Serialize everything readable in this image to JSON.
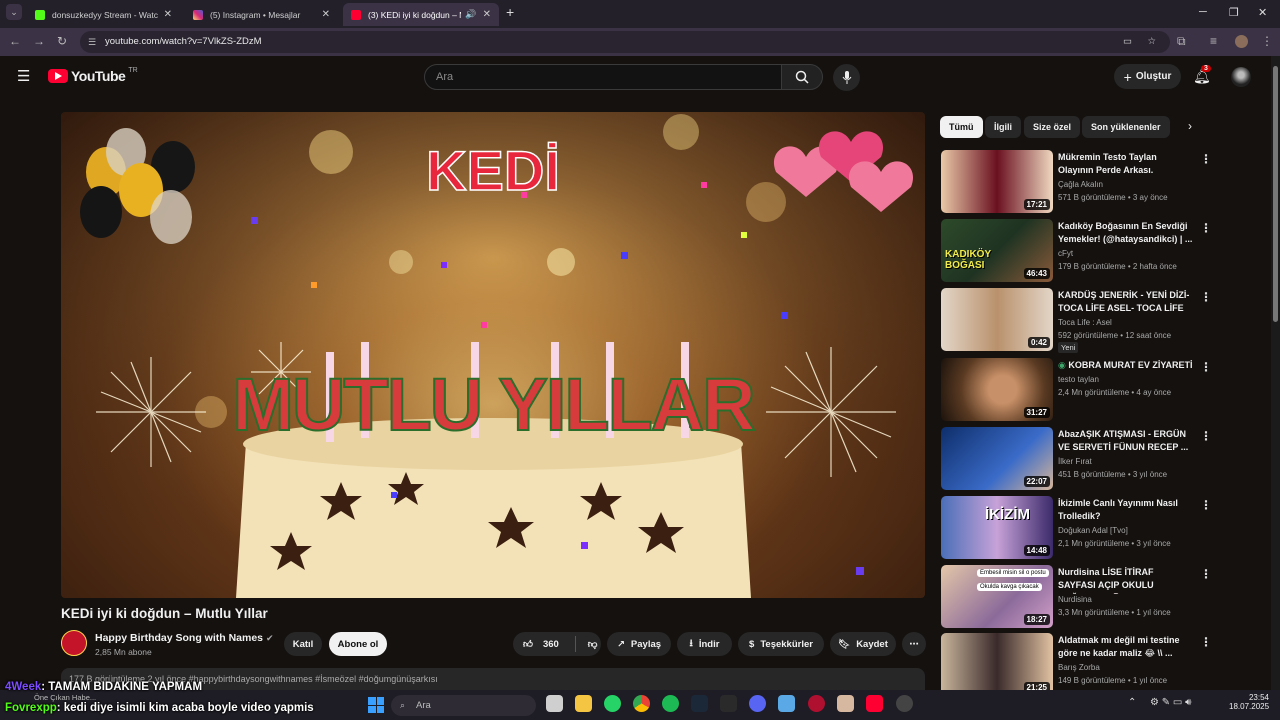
{
  "browser": {
    "tabs": [
      {
        "title": "donsuzkedyy Stream - Watch L",
        "color": "#53fc18"
      },
      {
        "title": "(5) Instagram • Mesajlar",
        "color": "#d6249f"
      },
      {
        "title": "(3) KEDi iyi ki doğdun – Mu",
        "color": "#ff0033"
      }
    ],
    "url": "youtube.com/watch?v=7VlkZS-ZDzM"
  },
  "youtube": {
    "logo": "YouTube",
    "region": "TR",
    "search_placeholder": "Ara",
    "create_label": "Oluştur",
    "notifications": "3"
  },
  "video": {
    "title": "KEDi iyi ki doğdun – Mutlu Yıllar",
    "thumb_word": "KEDİ",
    "thumb_text": "MUTLU YILLAR",
    "channel": "Happy Birthday Song with Names",
    "subscribers": "2,85 Mn abone",
    "join_label": "Katıl",
    "subscribe_label": "Abone ol",
    "likes": "360",
    "share_label": "Paylaş",
    "download_label": "İndir",
    "thanks_label": "Teşekkürler",
    "save_label": "Kaydet",
    "description": "177 B görüntüleme  2 yıl önce  #happybirthdaysongwithnames #İsmeözel #doğumgünüşarkısı"
  },
  "chips": [
    "Tümü",
    "İlgili",
    "Size özel",
    "Son yüklenenler"
  ],
  "recommendations": [
    {
      "title": "Mükremin Testo Taylan Olayının Perde Arkası.",
      "channel": "Çağla Akalın",
      "meta": "571 B görüntüleme • 3 ay önce",
      "duration": "17:21"
    },
    {
      "title": "Kadıköy Boğasının En Sevdiği Yemekler! (@hataysandikci) | ...",
      "channel": "cFyt",
      "meta": "179 B görüntüleme • 2 hafta önce",
      "duration": "46:43",
      "thumb_text": "KADIKÖY BOĞASI"
    },
    {
      "title": "KARDÜŞ JENERİK - YENİ DİZİ- TOCA LİFE ASEL- TOCA LİFE ...",
      "channel": "Toca Life : Asel",
      "meta": "592 görüntüleme • 12 saat önce",
      "duration": "0:42",
      "badge": "Yeni"
    },
    {
      "title": "KOBRA MURAT EV ZİYARETİ",
      "channel": "testo taylan",
      "meta": "2,4 Mn görüntüleme • 4 ay önce",
      "duration": "31:27"
    },
    {
      "title": "AbazAŞIK ATIŞMASI - ERGÜN VE SERVETİ FÜNUN RECEP ...",
      "channel": "İlker Fırat",
      "meta": "451 B görüntüleme • 3 yıl önce",
      "duration": "22:07"
    },
    {
      "title": "İkizimle Canlı Yayınımı Nasıl Trolledik?",
      "channel": "Doğukan Adal [Tvo]",
      "meta": "2,1 Mn görüntüleme • 3 yıl önce",
      "duration": "14:48",
      "thumb_text": "İKİZİM"
    },
    {
      "title": "Nurdisina LİSE İTİRAF SAYFASI AÇIP OKULU DAĞITIYOR 🗿 ...",
      "channel": "Nurdisina",
      "meta": "3,3 Mn görüntüleme • 1 yıl önce",
      "duration": "18:27",
      "thumb_text": "Embesil misin sil o postu",
      "thumb_text2": "Okulda kavga çıkacak"
    },
    {
      "title": "Aldatmak mı değil mi testine göre ne kadar maliz 😂 \\\\ ...",
      "channel": "Barış Zorba",
      "meta": "149 B görüntüleme • 1 yıl önce",
      "duration": "21:25"
    }
  ],
  "chat": [
    {
      "user": "4Week",
      "msg": ": TAMAM BIDAKINE YAPMAM",
      "color": "#7c4dff"
    },
    {
      "user": "Fovrexpp",
      "msg": ": kedi diye isimli kim acaba boyle video yapmis",
      "color": "#53fc18"
    }
  ],
  "taskbar": {
    "search_placeholder": "Ara",
    "featured_label": "Öne Çıkan Habe...",
    "time": "23:54",
    "date": "18.07.2025"
  }
}
